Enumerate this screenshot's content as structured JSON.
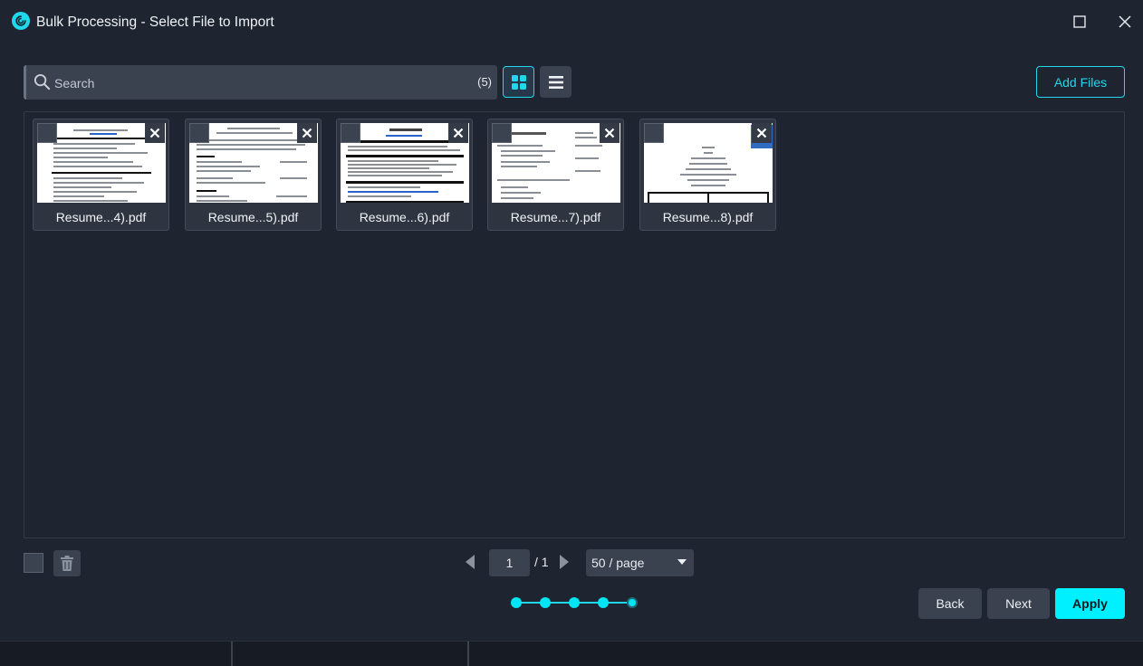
{
  "window": {
    "title": "Bulk Processing - Select File to Import"
  },
  "toolbar": {
    "search_placeholder": "Search",
    "search_value": "",
    "file_count": "(5)",
    "add_files_label": "Add Files"
  },
  "files": [
    {
      "name": "Resume...4).pdf"
    },
    {
      "name": "Resume...5).pdf"
    },
    {
      "name": "Resume...6).pdf"
    },
    {
      "name": "Resume...7).pdf"
    },
    {
      "name": "Resume...8).pdf"
    }
  ],
  "pagination": {
    "current_page": "1",
    "total_pages": "/ 1",
    "page_size": "50 / page"
  },
  "stepper": {
    "total_steps": 5,
    "current_step": 5
  },
  "actions": {
    "back_label": "Back",
    "next_label": "Next",
    "apply_label": "Apply"
  },
  "colors": {
    "accent": "#22d7ec",
    "apply": "#00f0ff",
    "background": "#1f2530",
    "control": "#3a4250"
  }
}
